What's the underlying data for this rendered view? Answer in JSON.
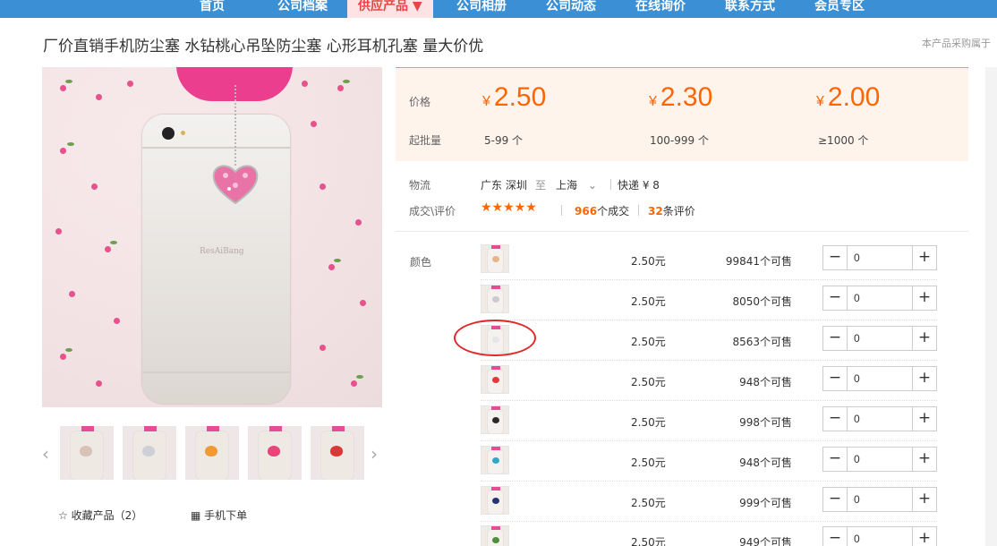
{
  "nav": {
    "items": [
      "首页",
      "公司档案",
      "供应产品 ▼",
      "公司相册",
      "公司动态",
      "在线询价",
      "联系方式",
      "会员专区"
    ],
    "active_index": 2
  },
  "product": {
    "title": "厂价直销手机防尘塞 水钻桃心吊坠防尘塞 心形耳机孔塞 量大价优",
    "note": "本产品采购属于"
  },
  "gallery": {
    "brand_text": "ResAiBang",
    "thumb_gem_colors": [
      "#d9c3b7",
      "#cfcfd6",
      "#f09a36",
      "#e8467a",
      "#d93838"
    ]
  },
  "actions": {
    "favorite_label": "收藏产品（2）",
    "mobile_label": "手机下单"
  },
  "pricing": {
    "price_label": "价格",
    "moq_label": "起批量",
    "currency": "¥",
    "tiers": [
      {
        "price": "2.50",
        "range": "5-99 个"
      },
      {
        "price": "2.30",
        "range": "100-999 个"
      },
      {
        "price": "2.00",
        "range": "≥1000 个"
      }
    ]
  },
  "logistics": {
    "label": "物流",
    "from": "广东 深圳",
    "to_word": "至",
    "dest": "上海",
    "shipping": "快递 ¥ 8"
  },
  "reviews": {
    "label": "成交\\评价",
    "stars": "★★★★★",
    "deals_count": "966",
    "deals_suffix": "个成交",
    "reviews_count": "32",
    "reviews_suffix": "条评价"
  },
  "sku": {
    "label": "颜色",
    "rows": [
      {
        "price": "2.50元",
        "stock": "99841个可售",
        "qty": "0",
        "gem": "#e8b488"
      },
      {
        "price": "2.50元",
        "stock": "8050个可售",
        "qty": "0",
        "gem": "#c9c9cf"
      },
      {
        "price": "2.50元",
        "stock": "8563个可售",
        "qty": "0",
        "gem": "#e6e6ea"
      },
      {
        "price": "2.50元",
        "stock": "948个可售",
        "qty": "0",
        "gem": "#e03a3a"
      },
      {
        "price": "2.50元",
        "stock": "998个可售",
        "qty": "0",
        "gem": "#2a2a2a"
      },
      {
        "price": "2.50元",
        "stock": "948个可售",
        "qty": "0",
        "gem": "#2fa7c9"
      },
      {
        "price": "2.50元",
        "stock": "999个可售",
        "qty": "0",
        "gem": "#27336e"
      },
      {
        "price": "2.50元",
        "stock": "949个可售",
        "qty": "0",
        "gem": "#4d8f3a"
      }
    ],
    "minus": "−",
    "plus": "+"
  },
  "colors": {
    "nav_bg": "#3b8fd4",
    "price_orange": "#ff6600",
    "price_box_bg": "#fef4ec",
    "highlight_circle": "#e02828"
  }
}
